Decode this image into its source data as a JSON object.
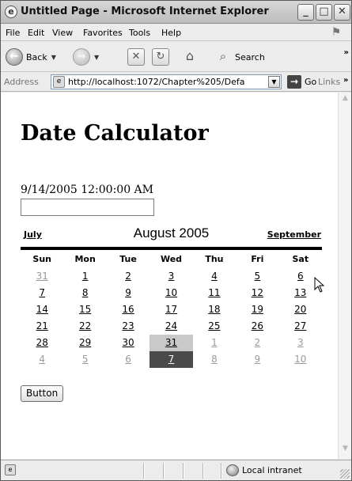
{
  "window": {
    "title": "Untitled Page - Microsoft Internet Explorer",
    "controls": {
      "minimize": "_",
      "maximize": "□",
      "close": "✕"
    }
  },
  "menu": [
    "File",
    "Edit",
    "View",
    "Favorites",
    "Tools",
    "Help"
  ],
  "toolbar": {
    "back_label": "Back",
    "search_label": "Search"
  },
  "address": {
    "label": "Address",
    "url": "http://localhost:1072/Chapter%205/Defa",
    "go_label": "Go",
    "links_label": "Links"
  },
  "page": {
    "title": "Date Calculator",
    "datetime": "9/14/2005 12:00:00 AM",
    "textbox_value": "",
    "button_label": "Button"
  },
  "calendar": {
    "prev_month": "July",
    "title": "August 2005",
    "next_month": "September",
    "day_headers": [
      "Sun",
      "Mon",
      "Tue",
      "Wed",
      "Thu",
      "Fri",
      "Sat"
    ],
    "weeks": [
      [
        {
          "d": "31",
          "other": true
        },
        {
          "d": "1"
        },
        {
          "d": "2"
        },
        {
          "d": "3"
        },
        {
          "d": "4"
        },
        {
          "d": "5"
        },
        {
          "d": "6"
        }
      ],
      [
        {
          "d": "7"
        },
        {
          "d": "8"
        },
        {
          "d": "9"
        },
        {
          "d": "10"
        },
        {
          "d": "11"
        },
        {
          "d": "12"
        },
        {
          "d": "13"
        }
      ],
      [
        {
          "d": "14"
        },
        {
          "d": "15"
        },
        {
          "d": "16"
        },
        {
          "d": "17"
        },
        {
          "d": "18"
        },
        {
          "d": "19"
        },
        {
          "d": "20"
        }
      ],
      [
        {
          "d": "21"
        },
        {
          "d": "22"
        },
        {
          "d": "23"
        },
        {
          "d": "24"
        },
        {
          "d": "25"
        },
        {
          "d": "26"
        },
        {
          "d": "27"
        }
      ],
      [
        {
          "d": "28"
        },
        {
          "d": "29"
        },
        {
          "d": "30"
        },
        {
          "d": "31",
          "today": true
        },
        {
          "d": "1",
          "other": true
        },
        {
          "d": "2",
          "other": true
        },
        {
          "d": "3",
          "other": true
        }
      ],
      [
        {
          "d": "4",
          "other": true
        },
        {
          "d": "5",
          "other": true
        },
        {
          "d": "6",
          "other": true
        },
        {
          "d": "7",
          "other": true,
          "selected": true
        },
        {
          "d": "8",
          "other": true
        },
        {
          "d": "9",
          "other": true
        },
        {
          "d": "10",
          "other": true
        }
      ]
    ]
  },
  "status": {
    "zone": "Local intranet"
  },
  "colors": {
    "today_bg": "#c9c9c9",
    "selected_bg": "#4a4a4a",
    "other_month_text": "#9a9a9a"
  }
}
